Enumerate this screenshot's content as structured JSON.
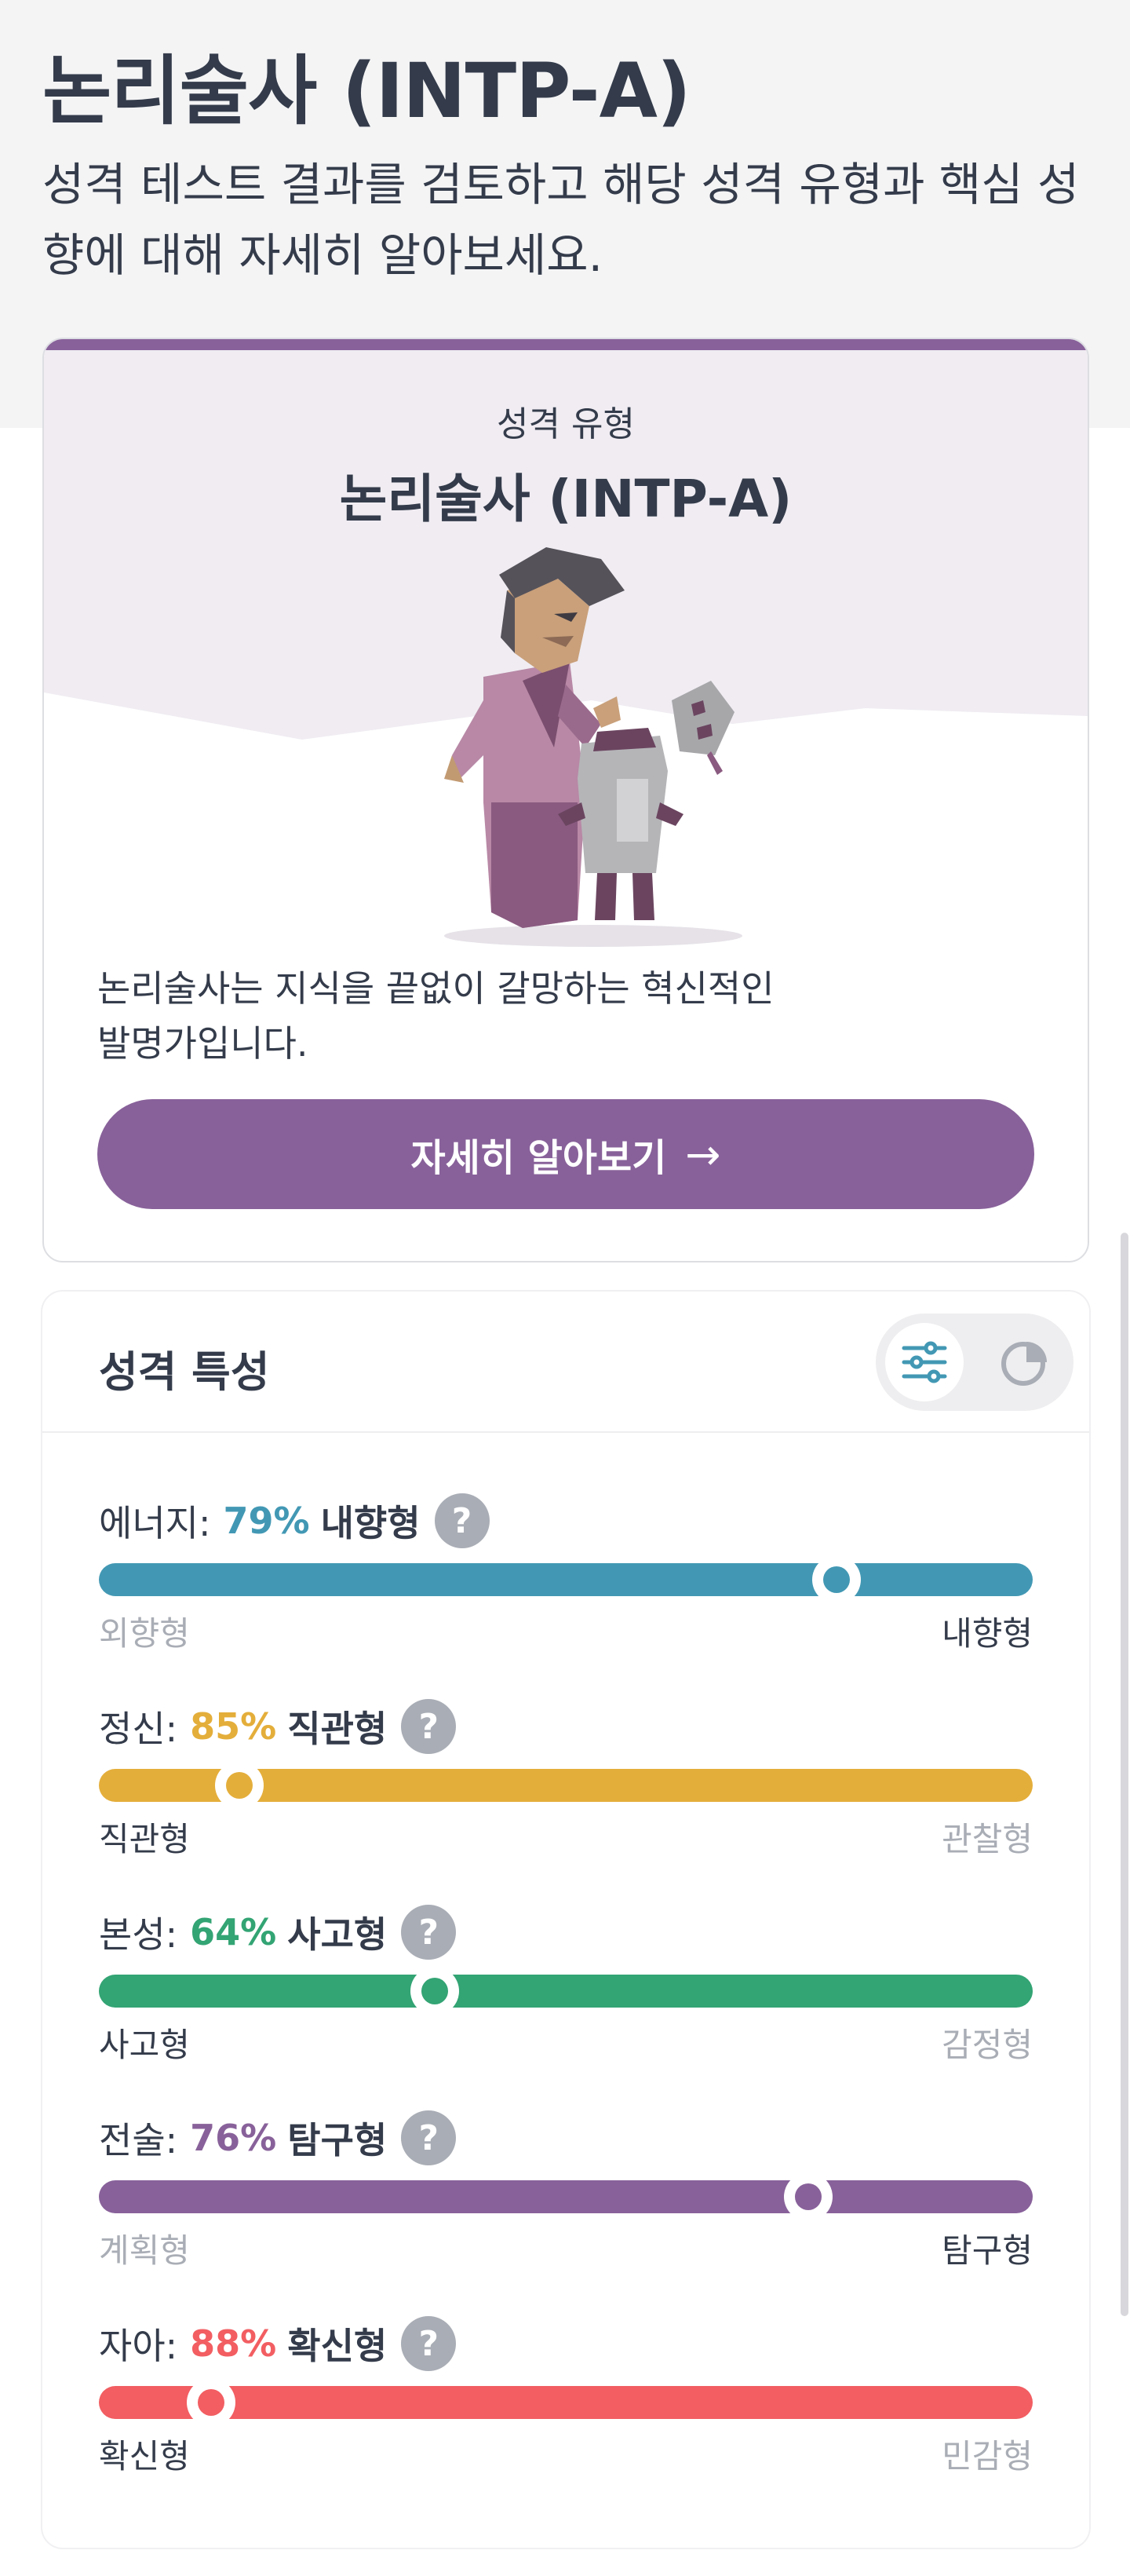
{
  "header": {
    "title": "논리술사 (INTP-A)",
    "subtitle": "성격 테스트 결과를 검토하고 해당 성격 유형과 핵심 성향에 대해 자세히 알아보세요."
  },
  "type_card": {
    "label": "성격 유형",
    "name": "논리술사 (INTP-A)",
    "description_line1": "논리술사는 지식을 끝없이 갈망하는 혁신적인",
    "description_line2": "발명가입니다.",
    "button_label": "자세히 알아보기",
    "button_icon": "arrow-right-icon",
    "accent_color": "#88619a"
  },
  "traits": {
    "title": "성격 특성",
    "view_toggle": [
      "sliders-icon",
      "pie-chart-icon"
    ],
    "items": [
      {
        "name": "에너지:",
        "percent": "79%",
        "type": "내향형",
        "value": 0.79,
        "left": "외향형",
        "right": "내향형",
        "active_side": "right",
        "color": "#4298b4"
      },
      {
        "name": "정신:",
        "percent": "85%",
        "type": "직관형",
        "value": 0.85,
        "left": "직관형",
        "right": "관찰형",
        "active_side": "left",
        "color": "#e4ae3a"
      },
      {
        "name": "본성:",
        "percent": "64%",
        "type": "사고형",
        "value": 0.64,
        "left": "사고형",
        "right": "감정형",
        "active_side": "left",
        "color": "#33a474"
      },
      {
        "name": "전술:",
        "percent": "76%",
        "type": "탐구형",
        "value": 0.76,
        "left": "계획형",
        "right": "탐구형",
        "active_side": "right",
        "color": "#88619a"
      },
      {
        "name": "자아:",
        "percent": "88%",
        "type": "확신형",
        "value": 0.88,
        "left": "확신형",
        "right": "민감형",
        "active_side": "left",
        "color": "#f25e62"
      }
    ]
  }
}
